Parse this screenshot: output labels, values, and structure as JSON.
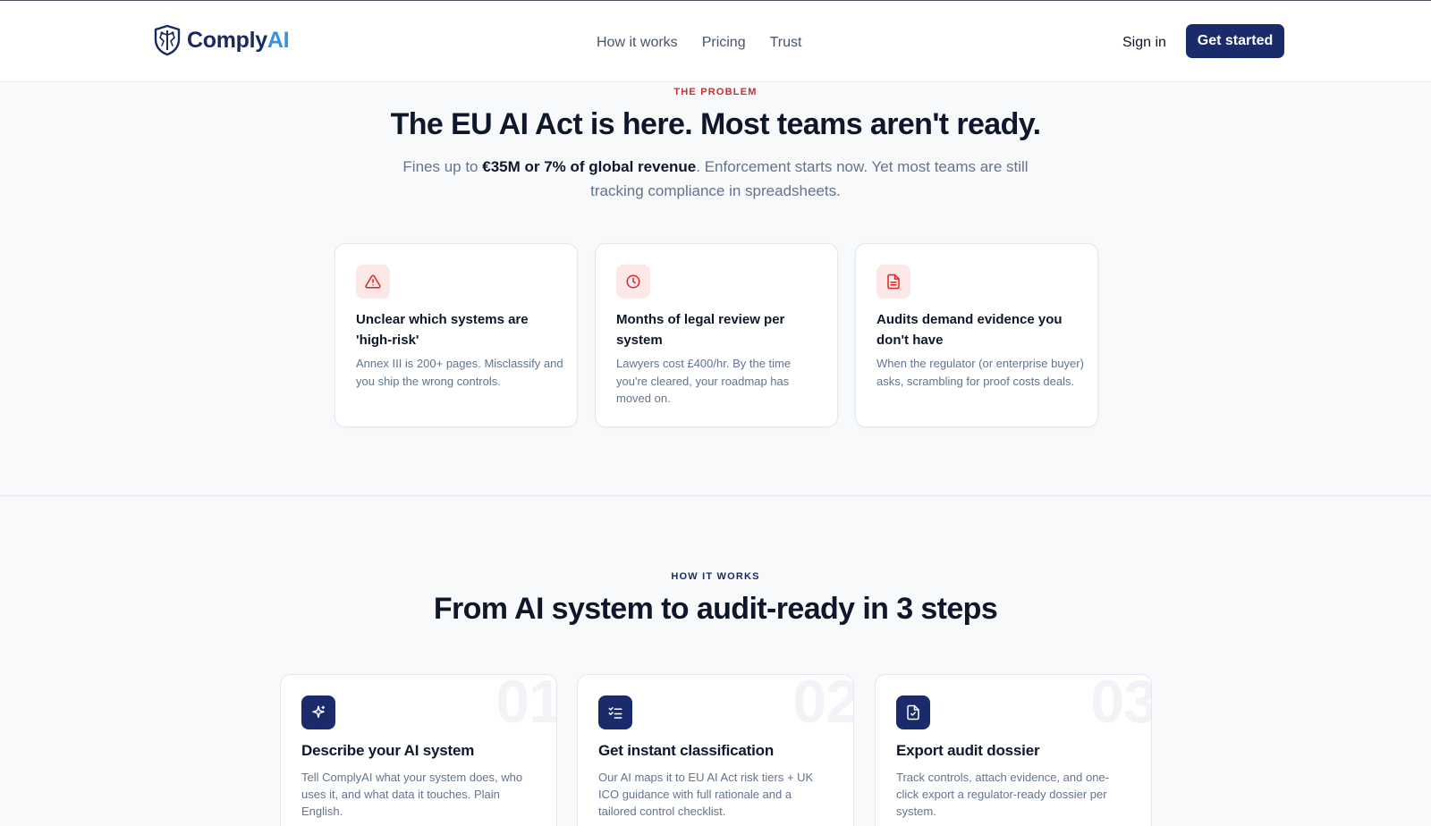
{
  "brand": {
    "name_part1": "Comply",
    "name_part2": "AI",
    "primary_color": "#1b2a6b",
    "accent_color": "#3d8fe0"
  },
  "nav": {
    "links": [
      {
        "label": "How it works"
      },
      {
        "label": "Pricing"
      },
      {
        "label": "Trust"
      }
    ],
    "sign_in": "Sign in",
    "cta": "Get started"
  },
  "problem": {
    "eyebrow": "THE PROBLEM",
    "title": "The EU AI Act is here. Most teams aren't ready.",
    "subtitle_pre": "Fines up to ",
    "subtitle_bold": "€35M or 7% of global revenue",
    "subtitle_post": ". Enforcement starts now. Yet most teams are still tracking compliance in spreadsheets.",
    "cards": [
      {
        "icon": "warning-triangle-icon",
        "title": "Unclear which systems are 'high-risk'",
        "desc": "Annex III is 200+ pages. Misclassify and you ship the wrong controls."
      },
      {
        "icon": "clock-icon",
        "title": "Months of legal review per system",
        "desc": "Lawyers cost £400/hr. By the time you're cleared, your roadmap has moved on."
      },
      {
        "icon": "document-icon",
        "title": "Audits demand evidence you don't have",
        "desc": "When the regulator (or enterprise buyer) asks, scrambling for proof costs deals."
      }
    ]
  },
  "how": {
    "eyebrow": "HOW IT WORKS",
    "title": "From AI system to audit-ready in 3 steps",
    "steps": [
      {
        "num": "01",
        "icon": "sparkle-icon",
        "title": "Describe your AI system",
        "desc": "Tell ComplyAI what your system does, who uses it, and what data it touches. Plain English."
      },
      {
        "num": "02",
        "icon": "checklist-icon",
        "title": "Get instant classification",
        "desc": "Our AI maps it to EU AI Act risk tiers + UK ICO guidance with full rationale and a tailored control checklist."
      },
      {
        "num": "03",
        "icon": "export-document-icon",
        "title": "Export audit dossier",
        "desc": "Track controls, attach evidence, and one-click export a regulator-ready dossier per system."
      }
    ]
  }
}
